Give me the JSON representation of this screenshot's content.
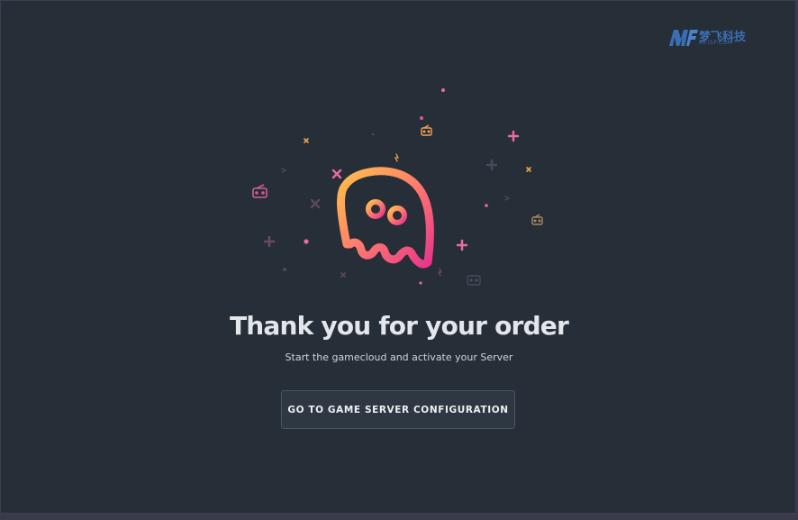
{
  "watermark": {
    "brand": "梦飞科技",
    "url": "MFISP.COM"
  },
  "illustration": {
    "icon": "ghost-icon",
    "decorations": [
      "plus-icon",
      "cross-icon",
      "gamepad-icon",
      "dot",
      "lightning-icon"
    ],
    "gradient": [
      "#ffb347",
      "#ff6b8b",
      "#e0407f"
    ]
  },
  "headline": "Thank you for your order",
  "subline": "Start the gamecloud and activate your Server",
  "cta": {
    "label": "GO TO GAME SERVER CONFIGURATION"
  },
  "colors": {
    "background": "#262e38",
    "button": "#2e3742",
    "text": "#e3e6ea"
  }
}
